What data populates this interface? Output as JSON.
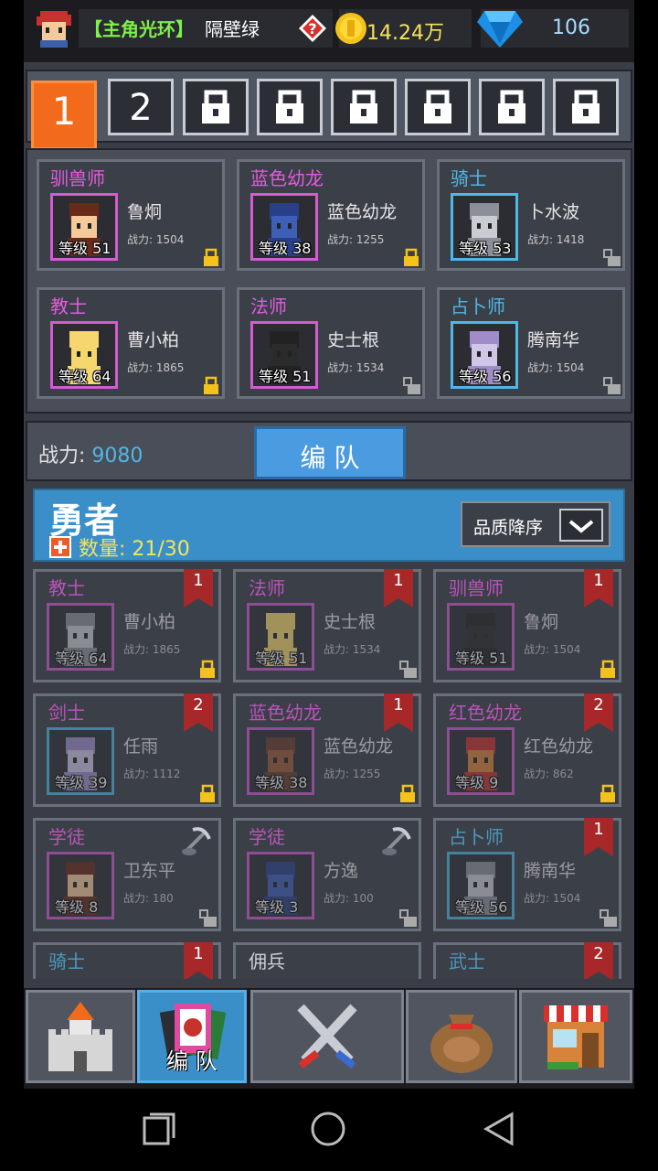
{
  "topbar": {
    "halo_label": "【主角光环】",
    "player_name": "隔壁绿",
    "gold": "14.24万",
    "gems": "106"
  },
  "tabs": [
    "1",
    "2"
  ],
  "power": {
    "label": "战力:",
    "value": "9080"
  },
  "form_button": "编 队",
  "formation": [
    {
      "job": "驯兽师",
      "job_color": "#e35bdf",
      "name": "鲁炯",
      "power": "战力: 1504",
      "level": "等级 51",
      "locked": true,
      "frame": "purple"
    },
    {
      "job": "蓝色幼龙",
      "job_color": "#e35bdf",
      "name": "蓝色幼龙",
      "power": "战力: 1255",
      "level": "等级 38",
      "locked": true,
      "frame": "purple"
    },
    {
      "job": "骑士",
      "job_color": "#4fb7e6",
      "name": "卜水波",
      "power": "战力: 1418",
      "level": "等级 53",
      "locked": false,
      "frame": "blue"
    },
    {
      "job": "教士",
      "job_color": "#e35bdf",
      "name": "曹小柏",
      "power": "战力: 1865",
      "level": "等级 64",
      "locked": true,
      "frame": "purple"
    },
    {
      "job": "法师",
      "job_color": "#e35bdf",
      "name": "史士根",
      "power": "战力: 1534",
      "level": "等级 51",
      "locked": false,
      "frame": "purple"
    },
    {
      "job": "占卜师",
      "job_color": "#4fb7e6",
      "name": "腾南华",
      "power": "战力: 1504",
      "level": "等级 56",
      "locked": false,
      "frame": "blue"
    }
  ],
  "heroes": {
    "title": "勇者",
    "count": "数量: 21/30",
    "sort_label": "品质降序",
    "list": [
      {
        "job": "教士",
        "job_color": "#e35bdf",
        "name": "曹小柏",
        "power": "战力: 1865",
        "level": "等级 64",
        "badge": "1",
        "lock": "closed",
        "frame": "purple"
      },
      {
        "job": "法师",
        "job_color": "#e35bdf",
        "name": "史士根",
        "power": "战力: 1534",
        "level": "等级 51",
        "badge": "1",
        "lock": "open",
        "frame": "purple"
      },
      {
        "job": "驯兽师",
        "job_color": "#e35bdf",
        "name": "鲁炯",
        "power": "战力: 1504",
        "level": "等级 51",
        "badge": "1",
        "lock": "closed",
        "frame": "purple"
      },
      {
        "job": "剑士",
        "job_color": "#e35bdf",
        "name": "任雨",
        "power": "战力: 1112",
        "level": "等级 39",
        "badge": "2",
        "lock": "closed",
        "frame": "blue"
      },
      {
        "job": "蓝色幼龙",
        "job_color": "#e35bdf",
        "name": "蓝色幼龙",
        "power": "战力: 1255",
        "level": "等级 38",
        "badge": "1",
        "lock": "closed",
        "frame": "purple"
      },
      {
        "job": "红色幼龙",
        "job_color": "#e35bdf",
        "name": "红色幼龙",
        "power": "战力: 862",
        "level": "等级 9",
        "badge": "2",
        "lock": "closed",
        "frame": "purple"
      },
      {
        "job": "学徒",
        "job_color": "#e35bdf",
        "name": "卫东平",
        "power": "战力: 180",
        "level": "等级 8",
        "badge": "",
        "lock": "open",
        "frame": "purple"
      },
      {
        "job": "学徒",
        "job_color": "#e35bdf",
        "name": "方逸",
        "power": "战力: 100",
        "level": "等级 3",
        "badge": "",
        "lock": "open",
        "frame": "purple"
      },
      {
        "job": "占卜师",
        "job_color": "#4fb7e6",
        "name": "腾南华",
        "power": "战力: 1504",
        "level": "等级 56",
        "badge": "1",
        "lock": "open",
        "frame": "blue"
      },
      {
        "job": "骑士",
        "job_color": "#4fb7e6",
        "name": "",
        "power": "",
        "level": "",
        "badge": "1",
        "lock": "",
        "frame": "blue"
      },
      {
        "job": "佣兵",
        "job_color": "#ffffff",
        "name": "",
        "power": "",
        "level": "",
        "badge": "",
        "lock": "",
        "frame": "blue"
      },
      {
        "job": "武士",
        "job_color": "#4fb7e6",
        "name": "",
        "power": "",
        "level": "",
        "badge": "2",
        "lock": "",
        "frame": "blue"
      }
    ]
  },
  "nav": {
    "formation_label": "编 队"
  }
}
